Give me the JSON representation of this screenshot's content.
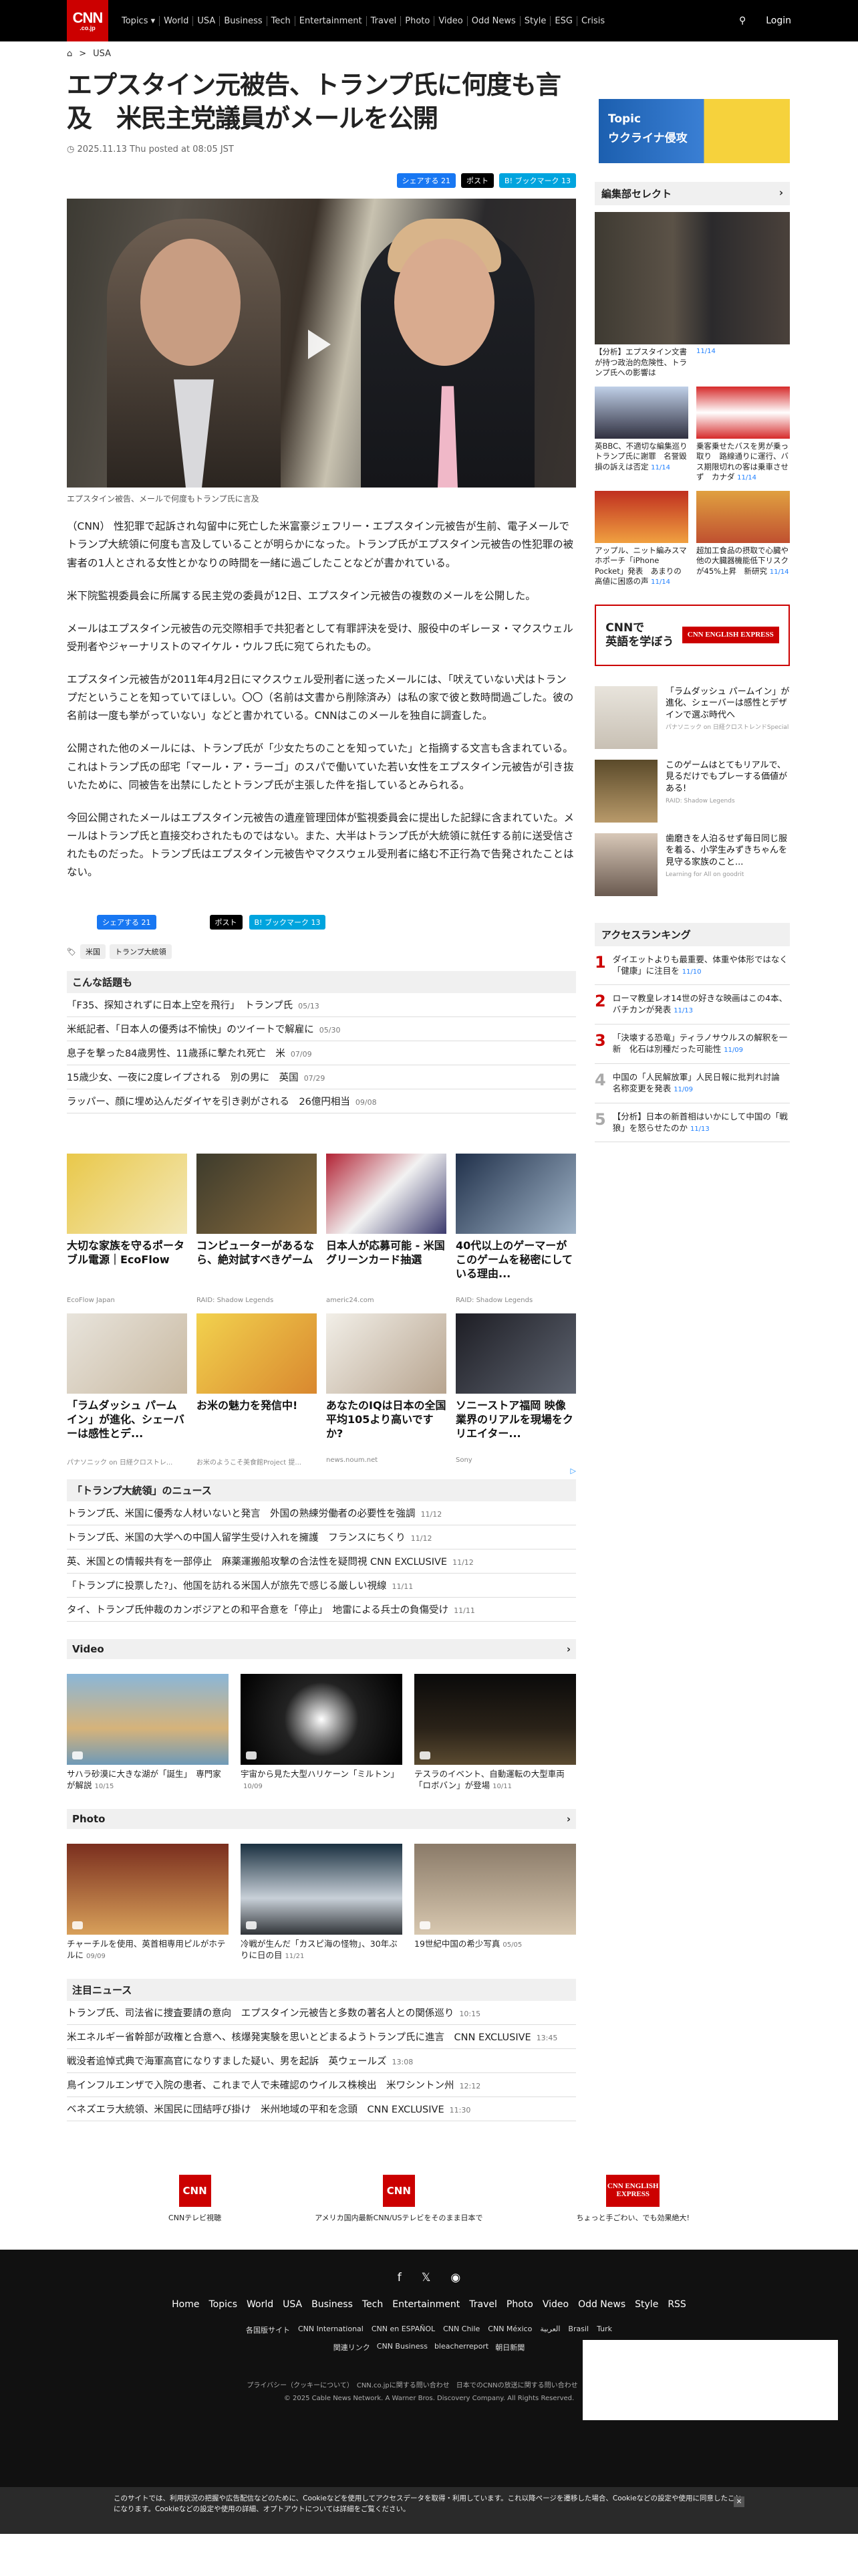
{
  "header": {
    "logo_top": "CNN",
    "logo_bottom": ".co.jp",
    "nav": [
      "Topics ▾",
      "World",
      "USA",
      "Business",
      "Tech",
      "Entertainment",
      "Travel",
      "Photo",
      "Video",
      "Odd News",
      "Style",
      "ESG",
      "Crisis"
    ],
    "login": "Login"
  },
  "breadcrumb": {
    "home": "⌂",
    "sep": ">",
    "current": "USA"
  },
  "article": {
    "title": "エプスタイン元被告、トランプ氏に何度も言及　米民主党議員がメールを公開",
    "date": "2025.11.13 Thu posted at 08:05 JST",
    "share": {
      "fb": "シェアする 21",
      "x": "ポスト",
      "hb": "B! ブックマーク 13"
    },
    "caption": "エプスタイン被告、メールで何度もトランプ氏に言及",
    "paragraphs": [
      "（CNN） 性犯罪で起訴され勾留中に死亡した米富豪ジェフリー・エプスタイン元被告が生前、電子メールでトランプ大統領に何度も言及していることが明らかになった。トランプ氏がエプスタイン元被告の性犯罪の被害者の1人とされる女性とかなりの時間を一緒に過ごしたことなどが書かれている。",
      "米下院監視委員会に所属する民主党の委員が12日、エプスタイン元被告の複数のメールを公開した。",
      "メールはエプスタイン元被告の元交際相手で共犯者として有罪評決を受け、服役中のギレーヌ・マクスウェル受刑者やジャーナリストのマイケル・ウルフ氏に宛てられたもの。",
      "エプスタイン元被告が2011年4月2日にマクスウェル受刑者に送ったメールには、「吠えていない犬はトランプだということを知っていてほしい。〇〇（名前は文書から削除済み）は私の家で彼と数時間過ごした。彼の名前は一度も挙がっていない」などと書かれている。CNNはこのメールを独自に調査した。",
      "公開された他のメールには、トランプ氏が「少女たちのことを知っていた」と指摘する文言も含まれている。これはトランプ氏の邸宅「マール・ア・ラーゴ」のスパで働いていた若い女性をエプスタイン元被告が引き抜いたために、同被告を出禁にしたとトランプ氏が主張した件を指しているとみられる。",
      "今回公開されたメールはエプスタイン元被告の遺産管理団体が監視委員会に提出した記録に含まれていた。メールはトランプ氏と直接交わされたものではない。また、大半はトランプ氏が大統領に就任する前に送受信されたものだった。トランプ氏はエプスタイン元被告やマクスウェル受刑者に絡む不正行為で告発されたことはない。"
    ],
    "tags": [
      "米国",
      "トランプ大統領"
    ]
  },
  "related": {
    "title": "こんな話題も",
    "items": [
      {
        "t": "「F35、探知されずに日本上空を飛行」　トランプ氏",
        "d": "05/13"
      },
      {
        "t": "米紙記者、「日本人の優秀は不愉快」のツイートで解雇に",
        "d": "05/30"
      },
      {
        "t": "息子を撃った84歳男性、11歳孫に撃たれ死亡　米",
        "d": "07/09"
      },
      {
        "t": "15歳少女、一夜に2度レイプされる　別の男に　英国",
        "d": "07/29"
      },
      {
        "t": "ラッパー、顔に埋め込んだダイヤを引き剥がされる　26億円相当",
        "d": "09/08"
      }
    ]
  },
  "promo_cards": [
    {
      "t": "大切な家族を守るポータブル電源｜EcoFlow",
      "s": "EcoFlow Japan"
    },
    {
      "t": "コンピューターがあるなら、絶対試すべきゲーム",
      "s": "RAID: Shadow Legends"
    },
    {
      "t": "日本人が応募可能 - 米国グリーンカード抽選",
      "s": "americ24.com"
    },
    {
      "t": "40代以上のゲーマーがこのゲームを秘密にしている理由...",
      "s": "RAID: Shadow Legends"
    },
    {
      "t": "「ラムダッシュ パームイン」が進化、シェーバーは感性とデ...",
      "s": "パナソニック on 日経クロストレ..."
    },
    {
      "t": "お米の魅力を発信中!",
      "s": "お米のようこそ美食館Project 提..."
    },
    {
      "t": "あなたのIQは日本の全国平均105より高いですか?",
      "s": "news.noum.net"
    },
    {
      "t": "ソニーストア福岡 映像業界のリアルを現場をクリエイター...",
      "s": "Sony"
    }
  ],
  "trump_news": {
    "title": "「トランプ大統領」のニュース",
    "items": [
      {
        "t": "トランプ氏、米国に優秀な人材いないと発言　外国の熟練労働者の必要性を強調",
        "d": "11/12"
      },
      {
        "t": "トランプ氏、米国の大学への中国人留学生受け入れを擁護　フランスにちくり",
        "d": "11/12"
      },
      {
        "t": "英、米国との情報共有を一部停止　麻薬運搬船攻撃の合法性を疑問視 CNN EXCLUSIVE",
        "d": "11/12"
      },
      {
        "t": "「トランプに投票した?」、他国を訪れる米国人が旅先で感じる厳しい視線",
        "d": "11/11"
      },
      {
        "t": "タイ、トランプ氏仲裁のカンボジアとの和平合意を「停止」　地雷による兵士の負傷受け",
        "d": "11/11"
      }
    ]
  },
  "video": {
    "title": "Video",
    "items": [
      {
        "t": "サハラ砂漠に大きな湖が「誕生」　専門家が解説",
        "d": "10/15"
      },
      {
        "t": "宇宙から見た大型ハリケーン「ミルトン」",
        "d": "10/09"
      },
      {
        "t": "テスラのイベント、自動運転の大型車両「ロボバン」が登場",
        "d": "10/11"
      }
    ]
  },
  "photo": {
    "title": "Photo",
    "items": [
      {
        "t": "チャーチルを使用、英首相専用ピルがホテルに",
        "d": "09/09"
      },
      {
        "t": "冷戦が生んだ「カスピ海の怪物」、30年ぶりに日の目",
        "d": "11/21"
      },
      {
        "t": "19世紀中国の希少写真",
        "d": "05/05"
      }
    ]
  },
  "featured": {
    "title": "注目ニュース",
    "items": [
      {
        "t": "トランプ氏、司法省に捜査要請の意向　エプスタイン元被告と多数の著名人との関係巡り",
        "d": "10:15"
      },
      {
        "t": "米エネルギー省幹部が政権と合意へ、核爆発実験を思いとどまるようトランプ氏に進言　CNN EXCLUSIVE",
        "d": "13:45"
      },
      {
        "t": "戦没者追悼式典で海軍高官になりすました疑い、男を起訴　英ウェールズ",
        "d": "13:08"
      },
      {
        "t": "鳥インフルエンザで入院の患者、これまで人で未確認のウイルス株検出　米ワシントン州",
        "d": "12:12"
      },
      {
        "t": "ベネズエラ大統領、米国民に団結呼び掛け　米州地域の平和を念頭　CNN EXCLUSIVE",
        "d": "11:30"
      }
    ]
  },
  "sidebar": {
    "topic_label": "Topic",
    "topic_title": "ウクライナ侵攻",
    "editor_title": "編集部セレクト",
    "editor_main": {
      "t": "【分析】エプスタイン文書が持つ政治的危険性、トランプ氏への影響は",
      "d": "11/14"
    },
    "editor_items": [
      {
        "t": "英BBC、不適切な編集巡りトランプ氏に謝罪　名誉毀損の訴えは否定",
        "d": "11/14"
      },
      {
        "t": "乗客乗せたバスを男が乗っ取り　路線通りに運行、バス期限切れの客は乗車させず　カナダ",
        "d": "11/14"
      },
      {
        "t": "アップル、ニット編みスマホポーチ「iPhone Pocket」発表　あまりの高値に困惑の声",
        "d": "11/14"
      },
      {
        "t": "超加工食品の摂取で心臓や他の大臓器機能低下リスクが45%上昇　新研究",
        "d": "11/14"
      }
    ],
    "cnn_box": {
      "line1": "CNNで",
      "line2": "英語を学ぼう",
      "logo": "CNN ENGLISH EXPRESS"
    },
    "ads": [
      {
        "t": "「ラムダッシュ パームイン」が進化、シェーバーは感性とデザインで選ぶ時代へ",
        "s": "パナソニック on 日経クロストレンドSpecial"
      },
      {
        "t": "このゲームはとてもリアルで、見るだけでもプレーする価値がある!",
        "s": "RAID: Shadow Legends"
      },
      {
        "t": "歯磨きを人泊るせず毎日同じ服を着る、小学生みずきちゃんを見守る家族のこと...",
        "s": "Learning for All on goodrit"
      }
    ],
    "ranking_title": "アクセスランキング",
    "ranking": [
      {
        "n": "1",
        "t": "ダイエットよりも最重要、体重や体形ではなく「健康」に注目を",
        "d": "11/10"
      },
      {
        "n": "2",
        "t": "ローマ教皇レオ14世の好きな映画はこの4本、バチカンが発表",
        "d": "11/13"
      },
      {
        "n": "3",
        "t": "「決壊する恐竜」ティラノサウルスの解釈を一新　化石は別種だった可能性",
        "d": "11/09"
      },
      {
        "n": "4",
        "t": "中国の「人民解放軍」人民日報に批判れ討論 名称変更を発表",
        "d": "11/09"
      },
      {
        "n": "5",
        "t": "【分析】日本の新首相はいかにして中国の「戦狼」を怒らせたのか",
        "d": "11/13"
      }
    ]
  },
  "footer_banners": [
    {
      "bx": "CNN",
      "t": "CNNテレビ視聴"
    },
    {
      "bx": "CNN",
      "t": "アメリカ国内最新CNN/USテレビをそのまま日本で"
    },
    {
      "bx": "CNN ENGLISH EXPRESS",
      "t": "ちょっと手ごわい、でも効果絶大!"
    }
  ],
  "footer": {
    "social": [
      "f",
      "𝕏",
      "◉"
    ],
    "links": [
      "Home",
      "Topics",
      "World",
      "USA",
      "Business",
      "Tech",
      "Entertainment",
      "Travel",
      "Photo",
      "Video",
      "Odd News",
      "Style",
      "RSS"
    ],
    "links2": [
      "各国版サイト",
      "CNN International",
      "CNN en ESPAÑOL",
      "CNN Chile",
      "CNN México",
      "العربية",
      "Brasil",
      "Turk"
    ],
    "links3": [
      "関連リンク",
      "CNN Business",
      "bleacherreport",
      "朝日新聞"
    ],
    "policy": "プライバシー（クッキーについて）　CNN.co.jpに関する問い合わせ　日本でのCNNの放送に関する問い合わせ　広告掲載",
    "copyright": "© 2025 Cable News Network. A Warner Bros. Discovery Company. All Rights Reserved."
  },
  "cookie": "このサイトでは、利用状況の把握や広告配信などのために、Cookieなどを使用してアクセスデータを取得・利用しています。これ以降ページを遷移した場合、Cookieなどの設定や使用に同意したことになります。Cookieなどの設定や使用の詳細、オプトアウトについては詳細をご覧ください。"
}
